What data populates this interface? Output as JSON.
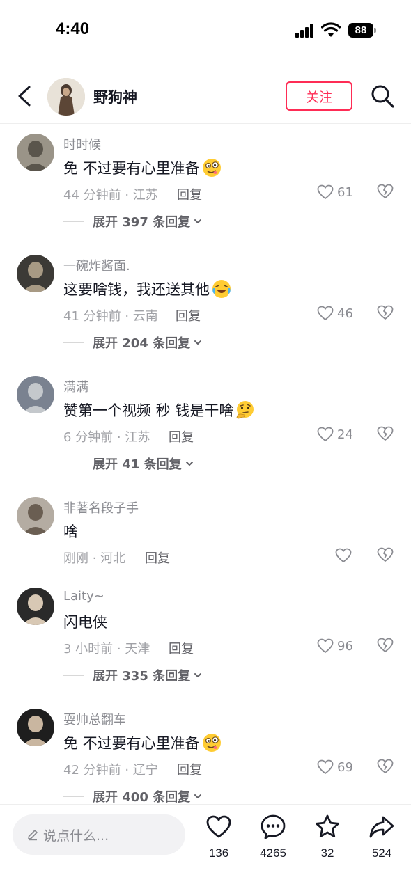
{
  "status_bar": {
    "time": "4:40",
    "battery": "88"
  },
  "header": {
    "username": "野狗神",
    "follow_label": "关注"
  },
  "comments": [
    {
      "user": "时时候",
      "text": "免 不过要有心里准备",
      "emoji": "drooling-face",
      "meta": "44 分钟前 · 江苏",
      "reply": "回复",
      "likes": "61",
      "expand": "展开 397 条回复"
    },
    {
      "user": "一碗炸酱面.",
      "text": "这要啥钱，我还送其他",
      "emoji": "laughing-crying-face",
      "meta": "41 分钟前 · 云南",
      "reply": "回复",
      "likes": "46",
      "expand": "展开 204 条回复"
    },
    {
      "user": "满满",
      "text": "赞第一个视频 秒  钱是干啥",
      "emoji": "thinking-face",
      "meta": "6 分钟前 · 江苏",
      "reply": "回复",
      "likes": "24",
      "expand": "展开 41 条回复"
    },
    {
      "user": "非著名段子手",
      "text": "啥",
      "emoji": "",
      "meta": "刚刚 · 河北",
      "reply": "回复",
      "likes": "",
      "expand": ""
    },
    {
      "user": "Laity~",
      "text": "闪电侠",
      "emoji": "",
      "meta": "3 小时前 · 天津",
      "reply": "回复",
      "likes": "96",
      "expand": "展开 335 条回复"
    },
    {
      "user": "耍帅总翻车",
      "text": "免 不过要有心里准备",
      "emoji": "drooling-face",
      "meta": "42 分钟前 · 辽宁",
      "reply": "回复",
      "likes": "69",
      "expand": "展开 400 条回复"
    }
  ],
  "bottom_bar": {
    "input_placeholder": "说点什么...",
    "likes": "136",
    "comments": "4265",
    "favorites": "32",
    "shares": "524"
  },
  "colors": {
    "accent": "#fe2c55",
    "text": "#161823",
    "muted": "#8a8b91"
  }
}
